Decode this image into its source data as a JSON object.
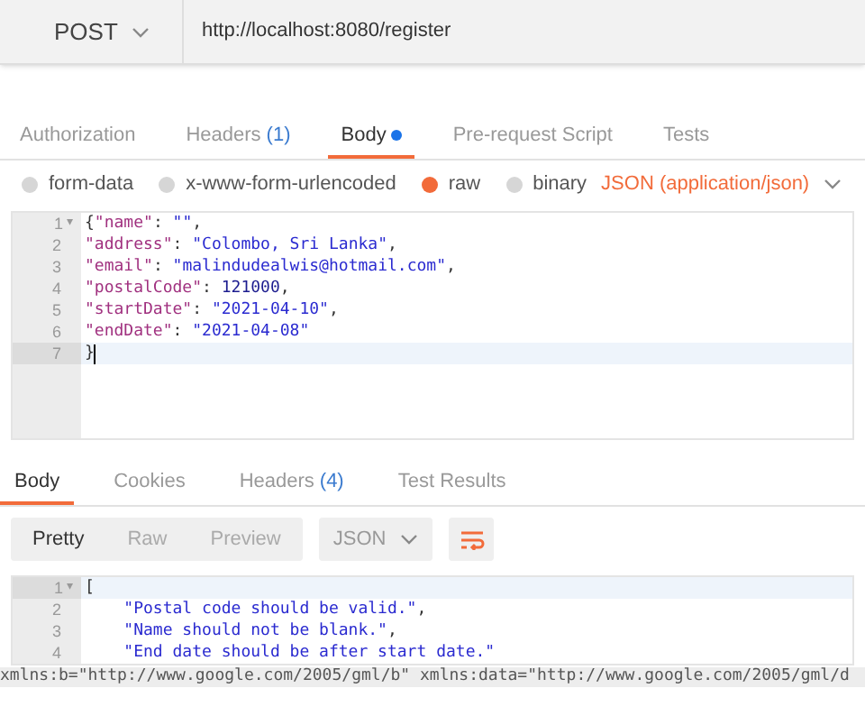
{
  "request": {
    "method": "POST",
    "url": "http://localhost:8080/register"
  },
  "request_tabs": [
    {
      "label": "Authorization",
      "dot": false,
      "selected": false
    },
    {
      "label": "Headers",
      "count": "(1)",
      "dot": false,
      "selected": false
    },
    {
      "label": "Body",
      "dot": true,
      "selected": true
    },
    {
      "label": "Pre-request Script",
      "dot": false,
      "selected": false
    },
    {
      "label": "Tests",
      "dot": false,
      "selected": false
    }
  ],
  "body_types": [
    {
      "label": "form-data",
      "selected": false
    },
    {
      "label": "x-www-form-urlencoded",
      "selected": false
    },
    {
      "label": "raw",
      "selected": true
    },
    {
      "label": "binary",
      "selected": false
    }
  ],
  "content_type": "JSON (application/json)",
  "request_editor": {
    "lines": [
      {
        "number": "1",
        "fold_marker": "▾",
        "current": false,
        "tokens": [
          {
            "kind": "punct",
            "text": "{"
          },
          {
            "kind": "key",
            "text": "\"name\""
          },
          {
            "kind": "punct",
            "text": ": "
          },
          {
            "kind": "string",
            "text": "\"\""
          },
          {
            "kind": "punct",
            "text": ","
          }
        ]
      },
      {
        "number": "2",
        "current": false,
        "tokens": [
          {
            "kind": "key",
            "text": "\"address\""
          },
          {
            "kind": "punct",
            "text": ": "
          },
          {
            "kind": "string",
            "text": "\"Colombo, Sri Lanka\""
          },
          {
            "kind": "punct",
            "text": ","
          }
        ]
      },
      {
        "number": "3",
        "current": false,
        "tokens": [
          {
            "kind": "key",
            "text": "\"email\""
          },
          {
            "kind": "punct",
            "text": ": "
          },
          {
            "kind": "string",
            "text": "\"malindudealwis@hotmail.com\""
          },
          {
            "kind": "punct",
            "text": ","
          }
        ]
      },
      {
        "number": "4",
        "current": false,
        "tokens": [
          {
            "kind": "key",
            "text": "\"postalCode\""
          },
          {
            "kind": "punct",
            "text": ": "
          },
          {
            "kind": "number",
            "text": "121000"
          },
          {
            "kind": "punct",
            "text": ","
          }
        ]
      },
      {
        "number": "5",
        "current": false,
        "tokens": [
          {
            "kind": "key",
            "text": "\"startDate\""
          },
          {
            "kind": "punct",
            "text": ": "
          },
          {
            "kind": "string",
            "text": "\"2021-04-10\""
          },
          {
            "kind": "punct",
            "text": ","
          }
        ]
      },
      {
        "number": "6",
        "current": false,
        "tokens": [
          {
            "kind": "key",
            "text": "\"endDate\""
          },
          {
            "kind": "punct",
            "text": ": "
          },
          {
            "kind": "string",
            "text": "\"2021-04-08\""
          }
        ]
      },
      {
        "number": "7",
        "current": true,
        "tokens": [
          {
            "kind": "punct",
            "text": "}"
          }
        ]
      }
    ]
  },
  "response_tabs": [
    {
      "label": "Body",
      "selected": true
    },
    {
      "label": "Cookies",
      "selected": false
    },
    {
      "label": "Headers",
      "count": "(4)",
      "selected": false
    },
    {
      "label": "Test Results",
      "selected": false
    }
  ],
  "view_modes": [
    {
      "label": "Pretty",
      "selected": true
    },
    {
      "label": "Raw",
      "selected": false
    },
    {
      "label": "Preview",
      "selected": false
    }
  ],
  "format": "JSON",
  "response_editor": {
    "lines": [
      {
        "number": "1",
        "fold_marker": "▾",
        "current": true,
        "tokens": [
          {
            "kind": "punct",
            "text": "["
          }
        ]
      },
      {
        "number": "2",
        "current": false,
        "tokens": [
          {
            "kind": "string",
            "text": "    \"Postal code should be valid.\""
          },
          {
            "kind": "punct",
            "text": ","
          }
        ]
      },
      {
        "number": "3",
        "current": false,
        "tokens": [
          {
            "kind": "string",
            "text": "    \"Name should not be blank.\""
          },
          {
            "kind": "punct",
            "text": ","
          }
        ]
      },
      {
        "number": "4",
        "current": false,
        "tokens": [
          {
            "kind": "string",
            "text": "    \"End date should be after start date.\""
          }
        ]
      }
    ]
  },
  "overflow_text": "xmlns:b=\"http://www.google.com/2005/gml/b\" xmlns:data=\"http://www.google.com/2005/gml/d"
}
